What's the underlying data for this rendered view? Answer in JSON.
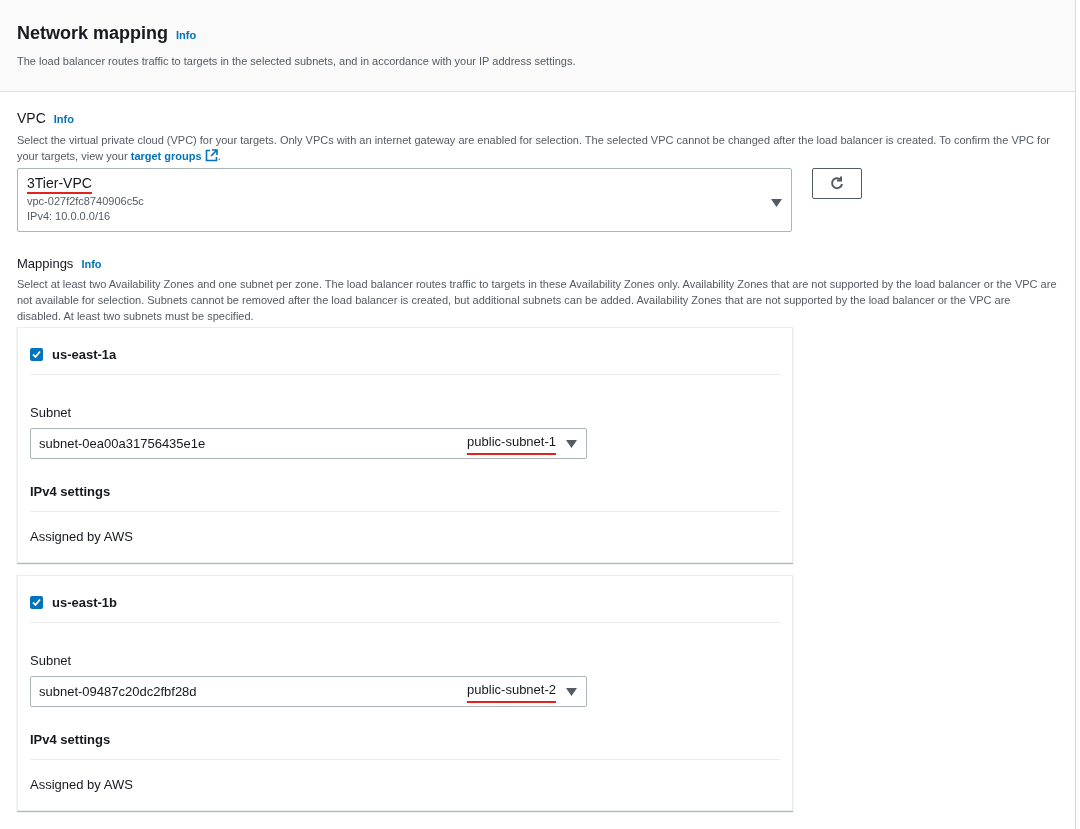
{
  "header": {
    "title": "Network mapping",
    "info": "Info",
    "description": "The load balancer routes traffic to targets in the selected subnets, and in accordance with your IP address settings."
  },
  "vpc": {
    "label": "VPC",
    "info": "Info",
    "description": "Select the virtual private cloud (VPC) for your targets. Only VPCs with an internet gateway are enabled for selection. The selected VPC cannot be changed after the load balancer is created. To confirm the VPC for your targets, view your ",
    "link": "target groups",
    "description_end": ".",
    "name": "3Tier-VPC",
    "name_underlined": true,
    "id": "vpc-027f2fc8740906c5c",
    "cidr": "IPv4: 10.0.0.0/16"
  },
  "mappings": {
    "label": "Mappings",
    "info": "Info",
    "description": "Select at least two Availability Zones and one subnet per zone. The load balancer routes traffic to targets in these Availability Zones only. Availability Zones that are not supported by the load balancer or the VPC are not available for selection. Subnets cannot be removed after the load balancer is created, but additional subnets can be added. Availability Zones that are not supported by the load balancer or the VPC are disabled. At least two subnets must be specified.",
    "zones": [
      {
        "zone": "us-east-1a",
        "checked": true,
        "subnet_label": "Subnet",
        "subnet_id": "subnet-0ea00a31756435e1e",
        "subnet_name": "public-subnet-1",
        "name_underlined": true,
        "ipv4_label": "IPv4 settings",
        "ipv4_value": "Assigned by AWS"
      },
      {
        "zone": "us-east-1b",
        "checked": true,
        "subnet_label": "Subnet",
        "subnet_id": "subnet-09487c20dc2fbf28d",
        "subnet_name": "public-subnet-2",
        "name_underlined": true,
        "ipv4_label": "IPv4 settings",
        "ipv4_value": "Assigned by AWS"
      }
    ]
  }
}
